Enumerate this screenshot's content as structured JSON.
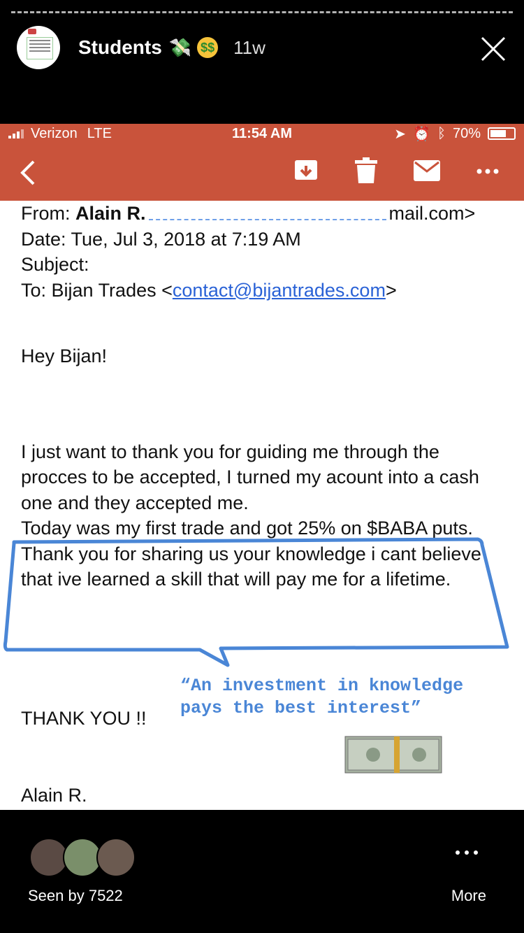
{
  "story": {
    "username": "Students",
    "age": "11w",
    "emoji1": "💸",
    "emoji2": "$$"
  },
  "statusbar": {
    "carrier": "Verizon",
    "network": "LTE",
    "time": "11:54 AM",
    "battery": "70%"
  },
  "email": {
    "from_label": "From:",
    "from_name": "Alain R.",
    "from_domain": "mail.com>",
    "date": "Date: Tue, Jul 3, 2018 at 7:19 AM",
    "subject": "Subject:",
    "to_prefix": "To: Bijan Trades <",
    "to_email": "contact@bijantrades.com",
    "to_suffix": ">",
    "greeting": "Hey Bijan!",
    "para1": "I just want to thank you for guiding me through the procces to be accepted, I turned my acount into a cash one and they accepted me.",
    "para2": "Today was my first trade and got 25% on $BABA puts. Thank you for sharing us your knowledge i cant believe that ive learned a skill that will pay me for a lifetime.",
    "quote_line1": "“An investment in knowledge",
    "quote_line2": "pays the best interest”",
    "thanks": "THANK YOU !!",
    "signoff": "Alain R."
  },
  "footer": {
    "seen_by": "Seen by 7522",
    "more": "More"
  },
  "colors": {
    "accent": "#c9533b",
    "link": "#2a62d6",
    "annotation": "#4a86d6"
  }
}
